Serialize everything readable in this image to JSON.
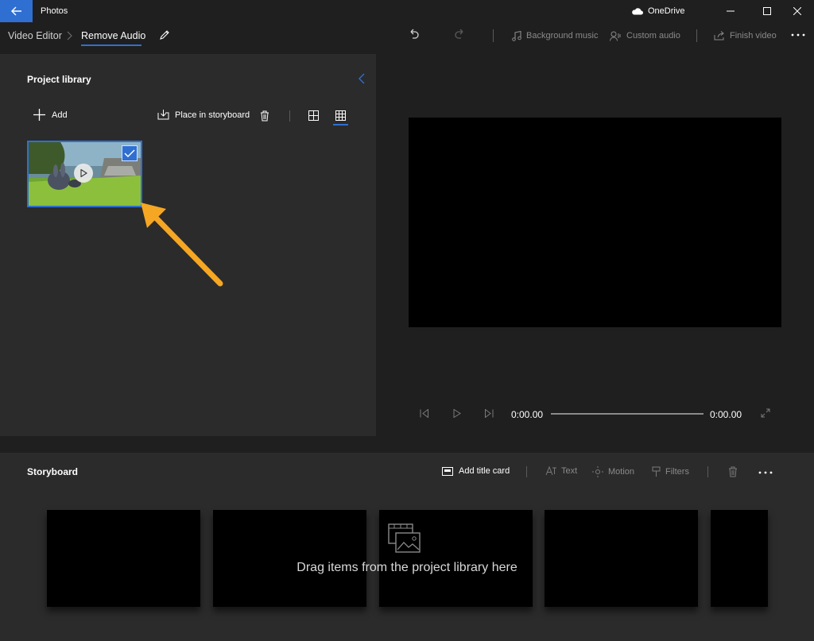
{
  "app": {
    "title": "Photos",
    "onedrive_label": "OneDrive"
  },
  "breadcrumb": {
    "root": "Video Editor",
    "current": "Remove Audio"
  },
  "toolbar": {
    "background_music": "Background music",
    "custom_audio": "Custom audio",
    "finish_video": "Finish video"
  },
  "library": {
    "title": "Project library",
    "add_label": "Add",
    "place_in_storyboard": "Place in storyboard",
    "selected_item_checked": true
  },
  "player": {
    "current_time": "0:00.00",
    "total_time": "0:00.00",
    "progress": 0
  },
  "storyboard": {
    "title": "Storyboard",
    "add_title_card": "Add title card",
    "text_label": "Text",
    "motion_label": "Motion",
    "filters_label": "Filters",
    "drop_hint": "Drag items from the project library here"
  },
  "colors": {
    "accent": "#2f6fd2",
    "annotation_arrow": "#f5a623"
  }
}
